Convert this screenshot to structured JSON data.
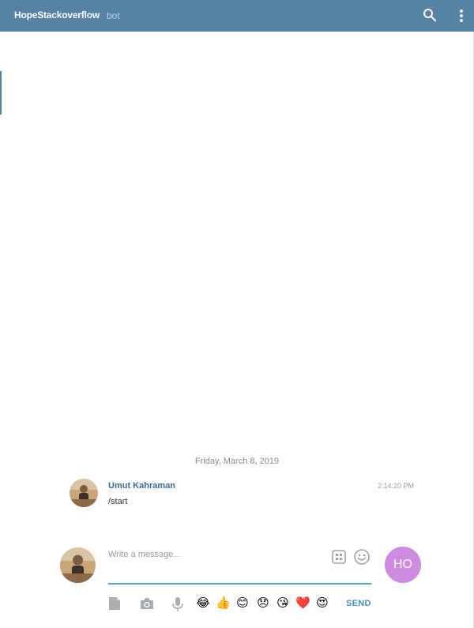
{
  "header": {
    "title": "HopeStackoverflow",
    "subtitle": "bot",
    "search_icon": "search-icon",
    "menu_icon": "more-vertical-icon"
  },
  "chat": {
    "date_separator": "Friday, March 8, 2019",
    "messages": [
      {
        "author": "Umut Kahraman",
        "text": "/start",
        "time": "2:14:20 PM"
      }
    ]
  },
  "compose": {
    "placeholder": "Write a message...",
    "value": "",
    "commands_icon": "commands-icon",
    "emoji_icon": "smile-icon",
    "peer_initials": "HO",
    "send_label": "SEND",
    "tools": [
      "document-icon",
      "camera-icon",
      "microphone-icon"
    ],
    "quick_emojis": [
      "😂",
      "👍",
      "😊",
      "😞",
      "😘",
      "❤️",
      "😍"
    ]
  },
  "colors": {
    "header_bg": "#5682a3",
    "accent": "#4b92c1",
    "peer_avatar": "#cf8be0"
  }
}
